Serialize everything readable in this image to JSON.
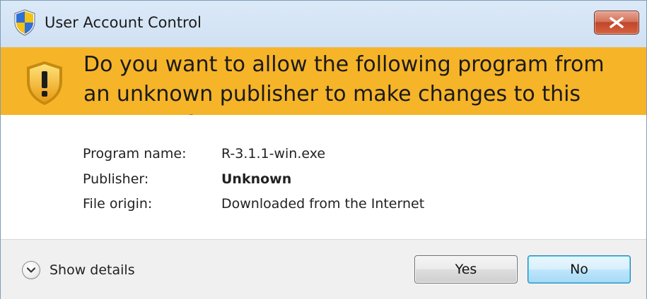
{
  "window": {
    "title": "User Account Control",
    "title_icon": "uac-shield-icon",
    "close_icon": "close-icon"
  },
  "banner": {
    "icon": "warning-shield-icon",
    "question": "Do you want to allow the following program from an unknown publisher to make changes to this computer?",
    "color": "#f6b428"
  },
  "details": {
    "program_label": "Program name:",
    "program_value": "R-3.1.1-win.exe",
    "publisher_label": "Publisher:",
    "publisher_value": "Unknown",
    "origin_label": "File origin:",
    "origin_value": "Downloaded from the Internet"
  },
  "footer": {
    "show_details_label": "Show details",
    "show_details_icon": "chevron-down-icon",
    "yes_label": "Yes",
    "no_label": "No"
  }
}
